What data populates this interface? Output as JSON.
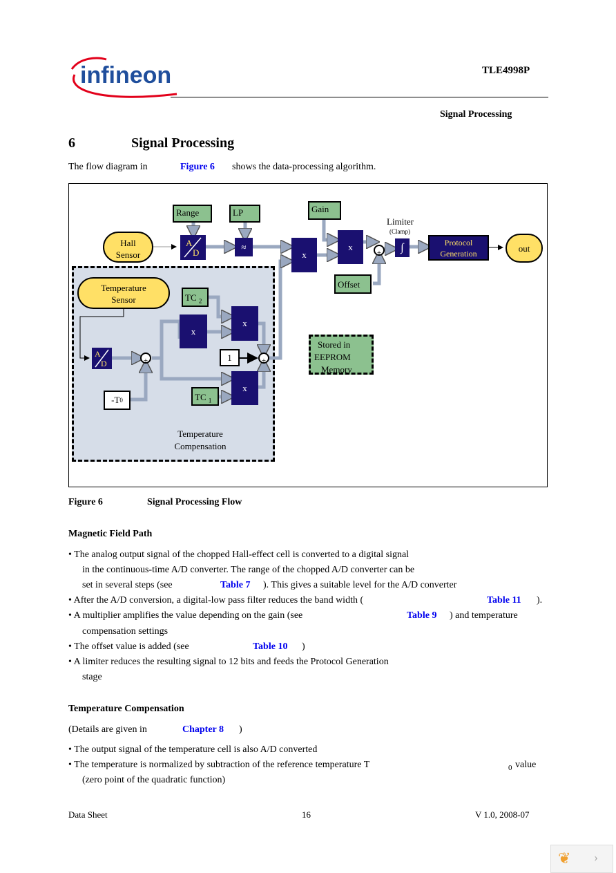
{
  "header": {
    "logo_text": "infineon",
    "product": "TLE4998P",
    "section": "Signal Processing"
  },
  "heading": {
    "number": "6",
    "title": "Signal Processing"
  },
  "intro": {
    "before": "The flow diagram in",
    "link": "Figure 6",
    "after": "shows the data-processing algorithm."
  },
  "diagram": {
    "hall_sensor": [
      "Hall",
      "Sensor"
    ],
    "range": "Range",
    "lp": "LP",
    "ad_a": "A",
    "ad_d": "D",
    "gain": "Gain",
    "offset": "Offset",
    "limiter": "Limiter",
    "clamp": "(Clamp)",
    "protocol": [
      "Protocol",
      "Generation"
    ],
    "out": "out",
    "temp_sensor": [
      "Temperature",
      "Sensor"
    ],
    "tc2": "TC",
    "tc2_sub": "2",
    "tc1": "TC",
    "tc1_sub": "1",
    "one": "1",
    "t0": "-T",
    "t0_sub": "0",
    "mult": "x",
    "plus": "+",
    "temp_comp": [
      "Temperature",
      "Compensation"
    ],
    "eeprom": [
      "Stored in",
      "EEPROM",
      "Memory"
    ],
    "colors": {
      "navy": "#1a1070",
      "green": "#8cc18f",
      "yellow": "#ffe066",
      "arrow": "#9aa8c0",
      "comp_bg": "#d6dde8"
    }
  },
  "caption": {
    "label": "Figure 6",
    "title": "Signal Processing Flow"
  },
  "magnetic": {
    "title": "Magnetic Field Path",
    "l1": "• The analog output signal of the chopped Hall-effect cell is converted to a digital signal",
    "l2": "in the continuous-time A/D converter. The range of the chopped A/D converter can be",
    "l3a": "set in several steps (see",
    "l3link": "Table 7",
    "l3b": "). This gives a suitable level for the A/D converter",
    "l4a": "• After the A/D conversion, a digital-low pass filter reduces the band width (",
    "l4link": "Table 11",
    "l4b": ").",
    "l5a": "• A multiplier amplifies the value depending on the gain (see",
    "l5link": "Table 9",
    "l5b": ") and temperature",
    "l6": "compensation settings",
    "l7a": "• The offset value is added (see",
    "l7link": "Table 10",
    "l7b": ")",
    "l8": "• A limiter reduces the resulting signal to 12 bits and feeds the Protocol Generation",
    "l9": "stage"
  },
  "tempcomp": {
    "title": "Temperature Compensation",
    "d_a": "(Details are given in",
    "d_link": "Chapter 8",
    "d_b": ")",
    "l1": "• The output signal of the temperature cell is also A/D converted",
    "l2": "• The temperature is normalized by subtraction of the reference temperature T",
    "l2sub": "0",
    "l2b": "value",
    "l3": "(zero point of the quadratic function)"
  },
  "footer": {
    "left": "Data Sheet",
    "center": "16",
    "right": "V 1.0, 2008-07"
  }
}
